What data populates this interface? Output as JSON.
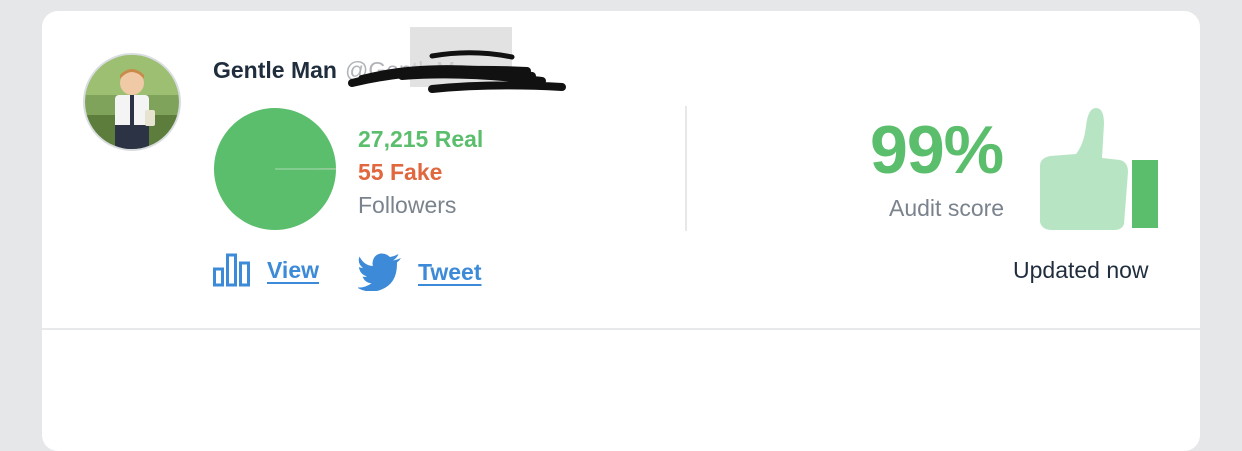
{
  "profile": {
    "name": "Gentle Man",
    "handle": "@GentleMan",
    "avatar_icon": "boy-avatar"
  },
  "followers": {
    "real_label": "27,215 Real",
    "fake_label": "55 Fake",
    "caption": "Followers",
    "real": 27215,
    "fake": 55
  },
  "audit": {
    "score": "99%",
    "label": "Audit score",
    "icon": "thumbs-up-icon"
  },
  "status": {
    "updated": "Updated now"
  },
  "actions": {
    "view_label": "View",
    "view_icon": "bar-chart-icon",
    "tweet_label": "Tweet",
    "tweet_icon": "twitter-bird-icon"
  },
  "colors": {
    "real": "#5bbe6c",
    "fake": "#e0673e",
    "link": "#3d8bd8",
    "thumb_light": "#b7e5c3"
  }
}
